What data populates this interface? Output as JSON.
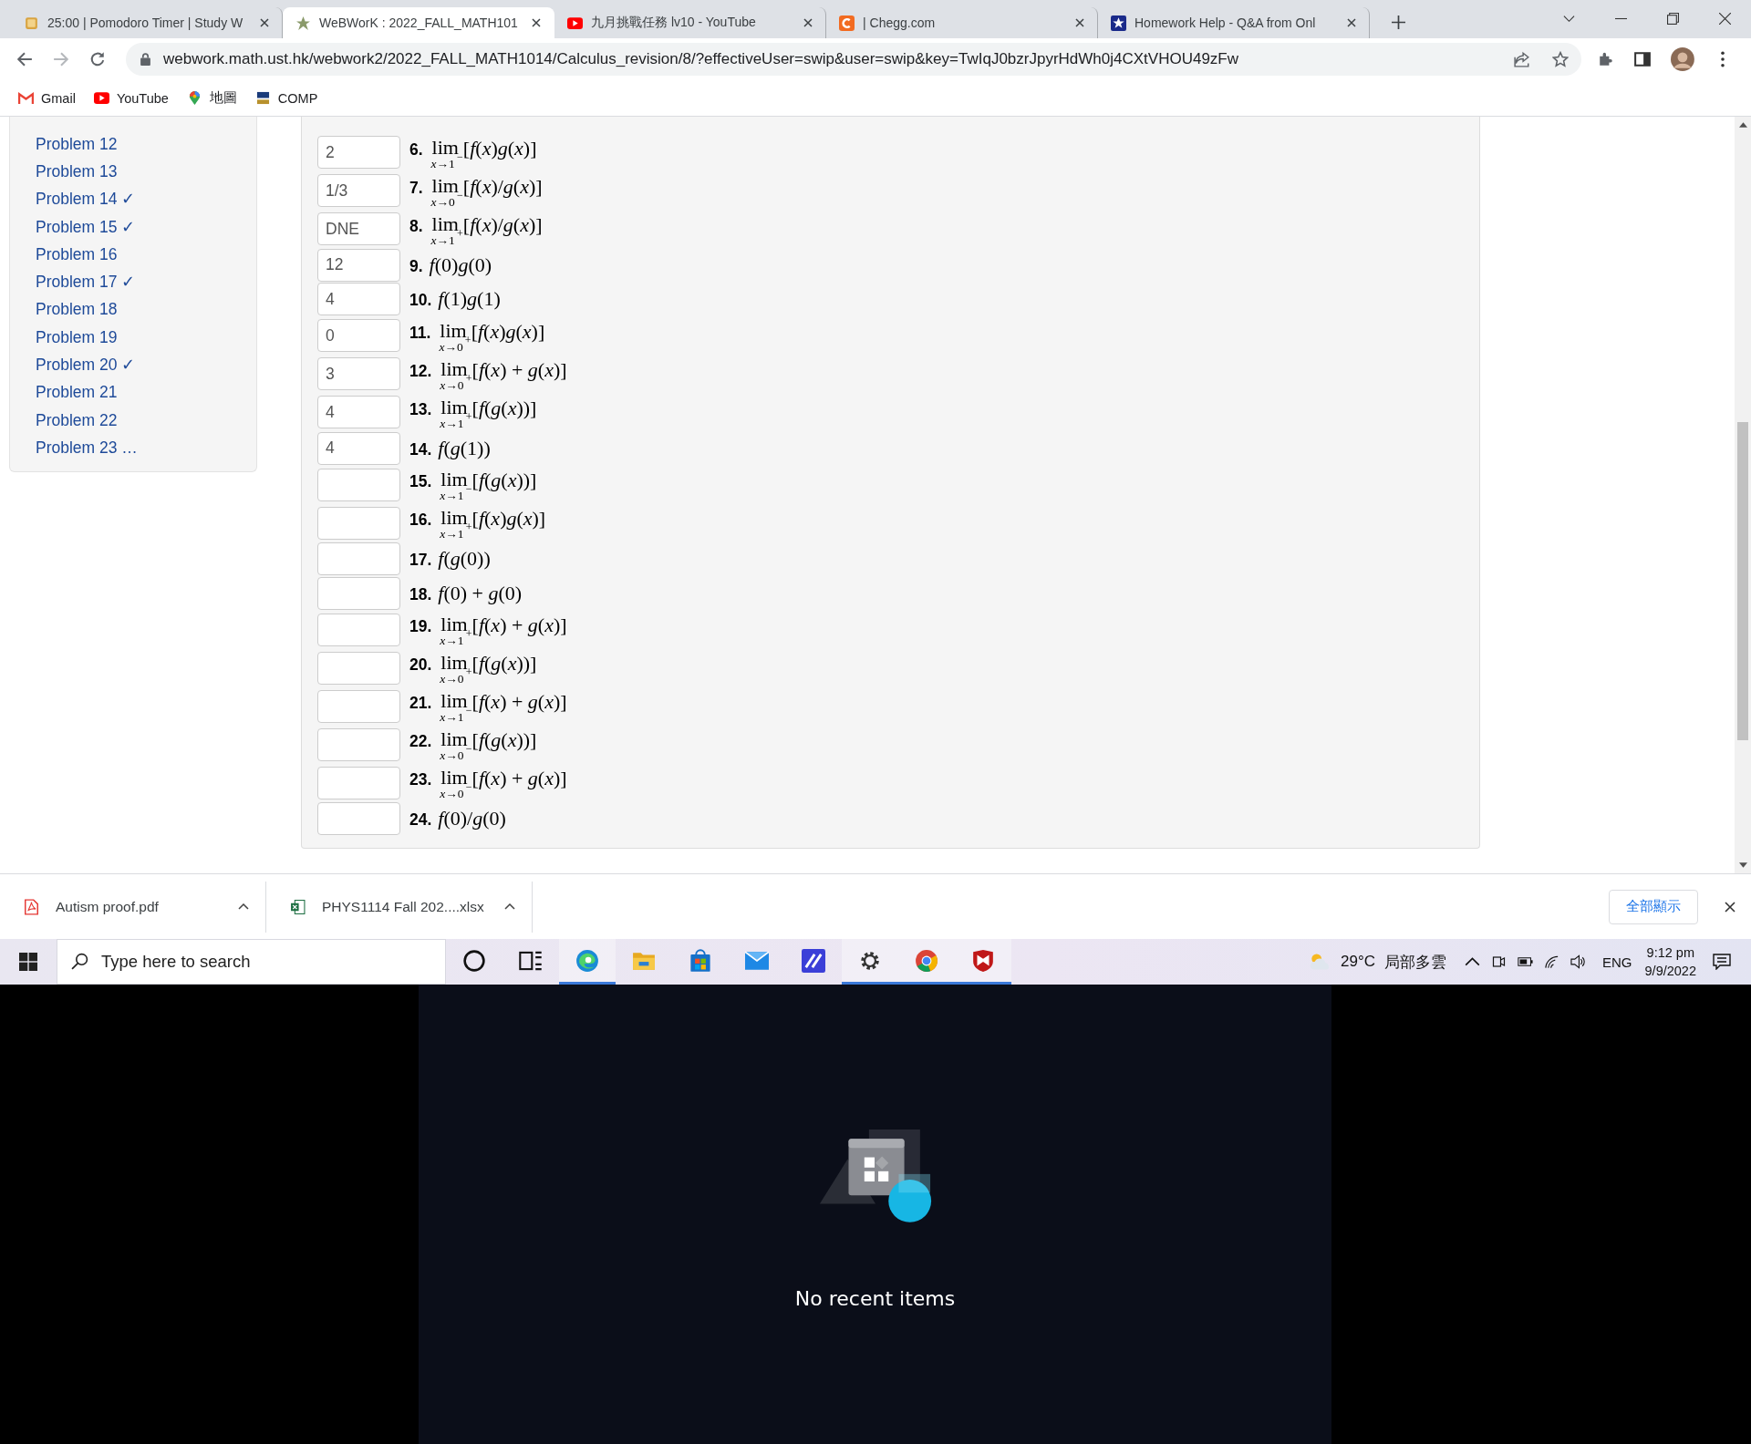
{
  "browser": {
    "tabs": [
      {
        "title": "25:00 | Pomodoro Timer | Study W",
        "selected": false
      },
      {
        "title": "WeBWorK : 2022_FALL_MATH101",
        "selected": true
      },
      {
        "title": "九月挑戰任務 lv10 - YouTube",
        "selected": false
      },
      {
        "title": "| Chegg.com",
        "selected": false
      },
      {
        "title": "Homework Help - Q&A from Onl",
        "selected": false
      }
    ],
    "address": "webwork.math.ust.hk/webwork2/2022_FALL_MATH1014/Calculus_revision/8/?effectiveUser=swip&user=swip&key=TwIqJ0bzrJpyrHdWh0j4CXtVHOU49zFw",
    "bookmarks": [
      {
        "label": "Gmail"
      },
      {
        "label": "YouTube"
      },
      {
        "label": "地圖"
      },
      {
        "label": "COMP"
      }
    ]
  },
  "sidebar": {
    "items": [
      {
        "label": "Problem 12"
      },
      {
        "label": "Problem 13"
      },
      {
        "label": "Problem 14",
        "mark": "✓"
      },
      {
        "label": "Problem 15",
        "mark": "✓"
      },
      {
        "label": "Problem 16"
      },
      {
        "label": "Problem 17",
        "mark": "✓"
      },
      {
        "label": "Problem 18"
      },
      {
        "label": "Problem 19"
      },
      {
        "label": "Problem 20",
        "mark": "✓"
      },
      {
        "label": "Problem 21"
      },
      {
        "label": "Problem 22"
      },
      {
        "label": "Problem 23",
        "mark": "…"
      }
    ]
  },
  "problems": [
    {
      "number": "6.",
      "kind": "limit",
      "operator": "lim",
      "approach": "*x*→1",
      "side": "−",
      "expression": "[*f*(*x*)*g*(*x*)]",
      "answer": "2"
    },
    {
      "number": "7.",
      "kind": "limit",
      "operator": "lim",
      "approach": "*x*→0",
      "side": "−",
      "expression": "[*f*(*x*)/*g*(*x*)]",
      "answer": "1/3"
    },
    {
      "number": "8.",
      "kind": "limit",
      "operator": "lim",
      "approach": "*x*→1",
      "side": "+",
      "expression": "[*f*(*x*)/*g*(*x*)]",
      "answer": "DNE"
    },
    {
      "number": "9.",
      "kind": "value",
      "expression": "*f*(0)*g*(0)",
      "answer": "12"
    },
    {
      "number": "10.",
      "kind": "value",
      "expression": "*f*(1)*g*(1)",
      "answer": "4"
    },
    {
      "number": "11.",
      "kind": "limit",
      "operator": "lim",
      "approach": "*x*→0",
      "side": "+",
      "expression": "[*f*(*x*)*g*(*x*)]",
      "answer": "0"
    },
    {
      "number": "12.",
      "kind": "limit",
      "operator": "lim",
      "approach": "*x*→0",
      "side": "+",
      "expression": "[*f*(*x*) + *g*(*x*)]",
      "answer": "3"
    },
    {
      "number": "13.",
      "kind": "limit",
      "operator": "lim",
      "approach": "*x*→1",
      "side": "+",
      "expression": "[*f*(*g*(*x*))]",
      "answer": "4"
    },
    {
      "number": "14.",
      "kind": "value",
      "expression": "*f*(*g*(1))",
      "answer": "4"
    },
    {
      "number": "15.",
      "kind": "limit",
      "operator": "lim",
      "approach": "*x*→1",
      "side": "−",
      "expression": "[*f*(*g*(*x*))]"
    },
    {
      "number": "16.",
      "kind": "limit",
      "operator": "lim",
      "approach": "*x*→1",
      "side": "+",
      "expression": "[*f*(*x*)*g*(*x*)]"
    },
    {
      "number": "17.",
      "kind": "value",
      "expression": "*f*(*g*(0))"
    },
    {
      "number": "18.",
      "kind": "value",
      "expression": "*f*(0) + *g*(0)"
    },
    {
      "number": "19.",
      "kind": "limit",
      "operator": "lim",
      "approach": "*x*→1",
      "side": "+",
      "expression": "[*f*(*x*) + *g*(*x*)]"
    },
    {
      "number": "20.",
      "kind": "limit",
      "operator": "lim",
      "approach": "*x*→0",
      "side": "+",
      "expression": "[*f*(*g*(*x*))]"
    },
    {
      "number": "21.",
      "kind": "limit",
      "operator": "lim",
      "approach": "*x*→1",
      "side": "−",
      "expression": "[*f*(*x*) + *g*(*x*)]"
    },
    {
      "number": "22.",
      "kind": "limit",
      "operator": "lim",
      "approach": "*x*→0",
      "side": "−",
      "expression": "[*f*(*g*(*x*))]"
    },
    {
      "number": "23.",
      "kind": "limit",
      "operator": "lim",
      "approach": "*x*→0",
      "side": "−",
      "expression": "[*f*(*x*) + *g*(*x*)]"
    },
    {
      "number": "24.",
      "kind": "value",
      "expression": "*f*(0)/*g*(0)"
    }
  ],
  "downloads": {
    "items": [
      {
        "filename": "Autism proof.pdf"
      },
      {
        "filename": "PHYS1114 Fall 202....xlsx"
      }
    ],
    "show_all": "全部顯示"
  },
  "taskbar": {
    "search_placeholder": "Type here to search",
    "apps": [
      {
        "running": true
      },
      {
        "running": false
      },
      {
        "running": false
      },
      {
        "running": false
      },
      {
        "running": false
      },
      {
        "running": true
      },
      {
        "running": true
      },
      {
        "running": true
      }
    ],
    "temperature": "29°C",
    "weather": "局部多雲",
    "language": "ENG",
    "time": "9:12 pm",
    "date": "9/9/2022"
  },
  "start_panel": {
    "message": "No recent items"
  }
}
